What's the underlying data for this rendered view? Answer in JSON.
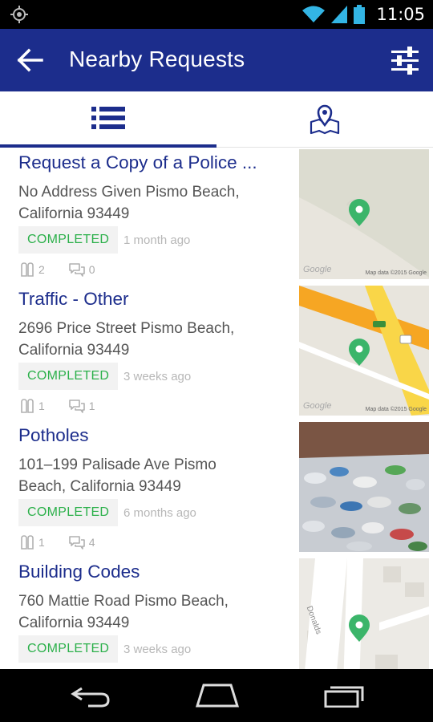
{
  "status_bar": {
    "time": "11:05",
    "icons": [
      "location-icon",
      "wifi-icon",
      "signal-icon",
      "battery-icon"
    ]
  },
  "app_bar": {
    "title": "Nearby Requests",
    "back_icon": "back-arrow-icon",
    "filter_icon": "filter-sliders-icon"
  },
  "tabs": [
    {
      "icon": "list-view-icon",
      "selected": true
    },
    {
      "icon": "map-view-icon",
      "selected": false
    }
  ],
  "requests": [
    {
      "title": "Request a Copy of a Police ...",
      "address_line1": "No Address Given Pismo Beach,",
      "address_line2": "California 93449",
      "status": "COMPLETED",
      "time": "1 month ago",
      "followers": "2",
      "comments": "0",
      "thumbnail": "map",
      "map_credit_left": "Google",
      "map_credit_right": "Map data ©2015 Google"
    },
    {
      "title": "Traffic - Other",
      "address_line1": "2696  Price Street Pismo Beach,",
      "address_line2": "California 93449",
      "status": "COMPLETED",
      "time": "3 weeks ago",
      "followers": "1",
      "comments": "1",
      "thumbnail": "map",
      "map_credit_left": "Google",
      "map_credit_right": "Map data ©2015 Google"
    },
    {
      "title": "Potholes",
      "address_line1": "101–199  Palisade Ave Pismo",
      "address_line2": "Beach, California 93449",
      "status": "COMPLETED",
      "time": "6 months ago",
      "followers": "1",
      "comments": "4",
      "thumbnail": "photo"
    },
    {
      "title": "Building Codes",
      "address_line1": "760  Mattie Road Pismo Beach,",
      "address_line2": "California 93449",
      "status": "COMPLETED",
      "time": "3 weeks ago",
      "followers": "",
      "comments": "",
      "thumbnail": "map",
      "map_street_label": "Donalds"
    }
  ],
  "colors": {
    "primary": "#1c2d8c",
    "status_completed": "#2bb04a",
    "pin": "#3bb56a"
  },
  "nav_bar": {
    "icons": [
      "back-nav-icon",
      "home-nav-icon",
      "recents-nav-icon"
    ]
  }
}
